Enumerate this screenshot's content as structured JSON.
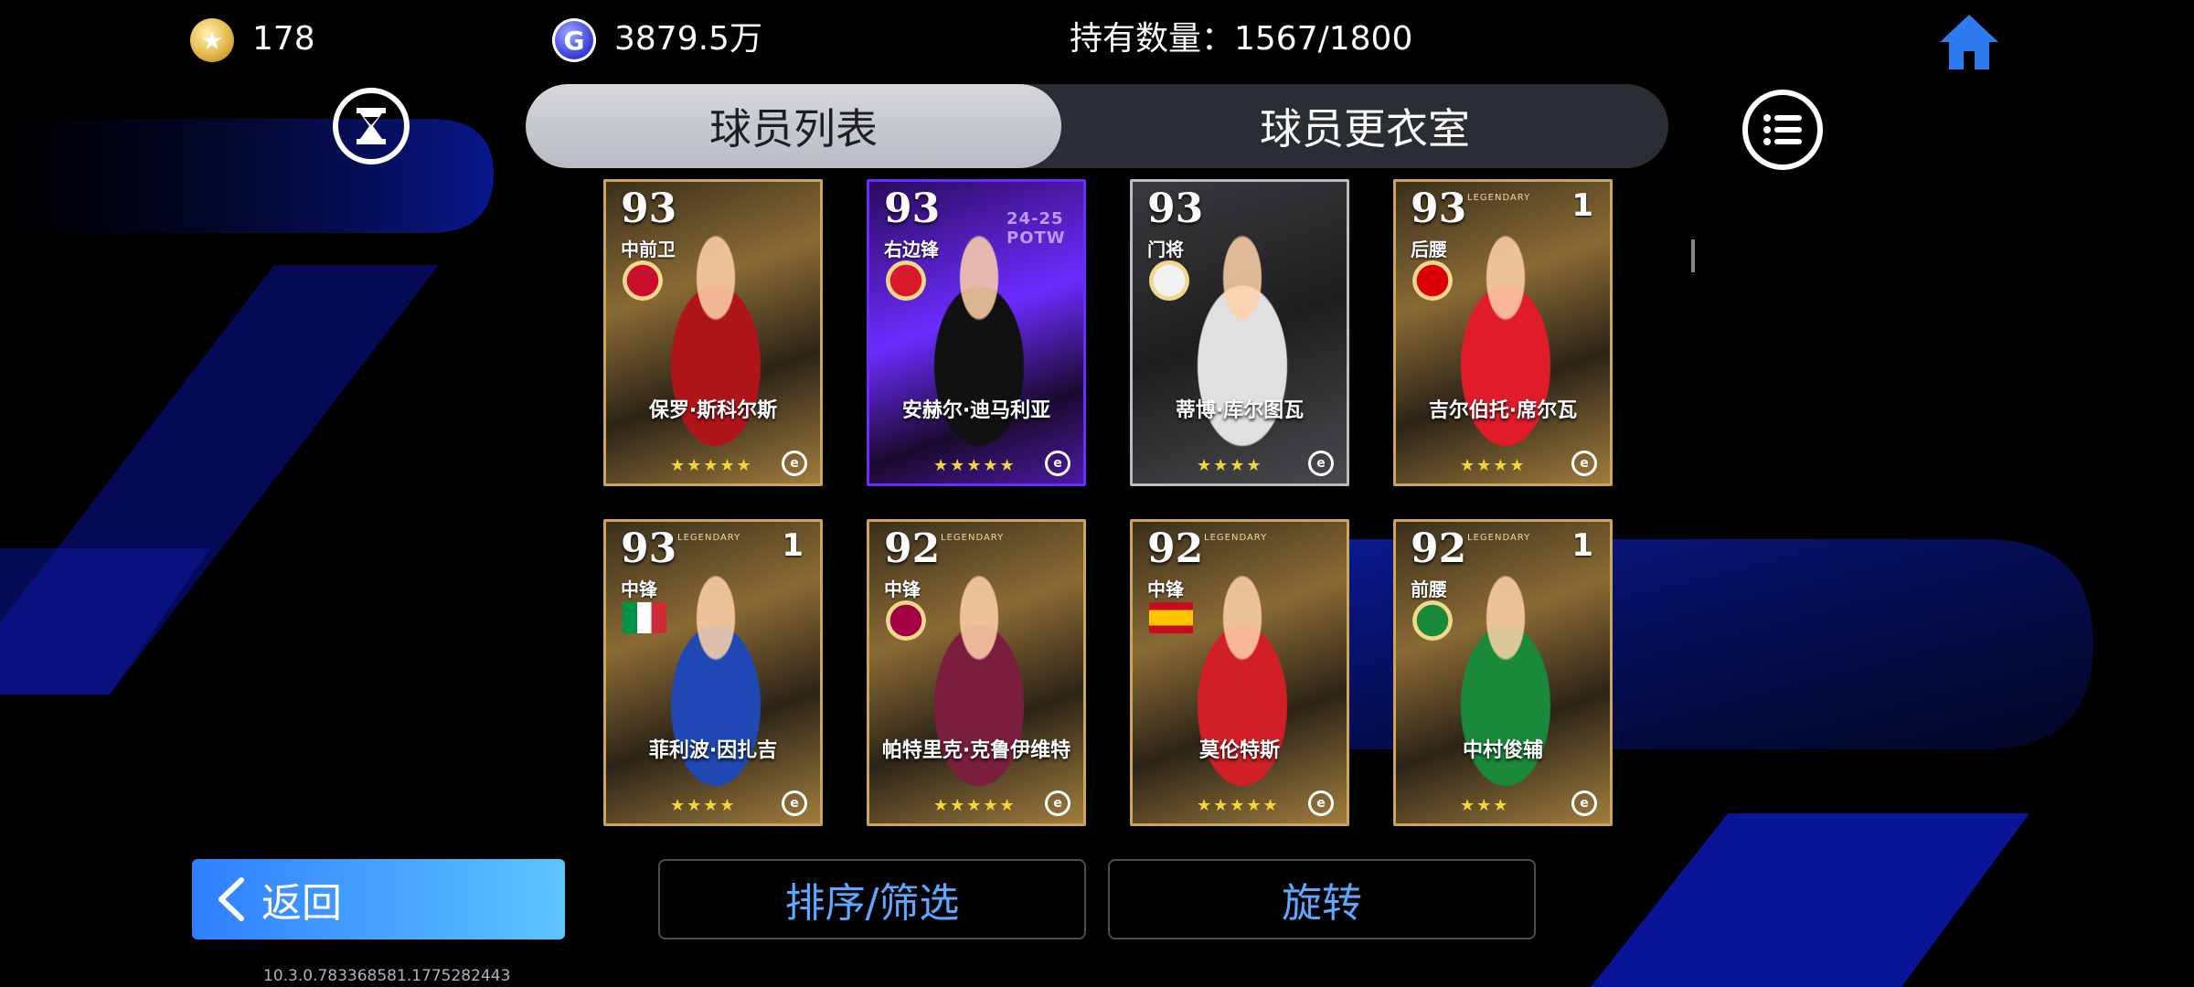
{
  "header": {
    "coins": "178",
    "gp": "3879.5万",
    "ownership": "持有数量：1567/1800",
    "gp_symbol": "G"
  },
  "tabs": [
    {
      "label": "球员列表",
      "active": true
    },
    {
      "label": "球员更衣室",
      "active": false
    }
  ],
  "cards": [
    {
      "rating": "93",
      "position": "中前卫",
      "name": "保罗·斯科尔斯",
      "stars": "★★★★★",
      "level": "",
      "tag": "",
      "style": "gold",
      "kit": "#b0141b",
      "badge": "manchester-united-badge",
      "badge_color": "#c8102e"
    },
    {
      "rating": "93",
      "position": "右边锋",
      "name": "安赫尔·迪马利亚",
      "stars": "★★★★★",
      "level": "",
      "tag": "24-25 POTW",
      "style": "potw",
      "kit": "#111",
      "badge": "benfica-badge",
      "badge_color": "#d81a2a"
    },
    {
      "rating": "93",
      "position": "门将",
      "name": "蒂博·库尔图瓦",
      "stars": "★★★★",
      "level": "",
      "tag": "",
      "style": "silver",
      "kit": "#e0e0e0",
      "badge": "real-madrid-badge",
      "badge_color": "#f2f2f2"
    },
    {
      "rating": "93",
      "position": "后腰",
      "name": "吉尔伯托·席尔瓦",
      "stars": "★★★★",
      "level": "1",
      "tag": "LEGENDARY",
      "style": "gold",
      "kit": "#e01c2a",
      "badge": "arsenal-badge",
      "badge_color": "#db0007"
    },
    {
      "rating": "93",
      "position": "中锋",
      "name": "菲利波·因扎吉",
      "stars": "★★★★",
      "level": "1",
      "tag": "LEGENDARY",
      "style": "gold",
      "kit": "#1f48b4",
      "badge": "italy-flag",
      "badge_color": ""
    },
    {
      "rating": "92",
      "position": "中锋",
      "name": "帕特里克·克鲁伊维特",
      "stars": "★★★★★",
      "level": "",
      "tag": "LEGENDARY",
      "style": "gold",
      "kit": "#7b1d3c",
      "badge": "barcelona-badge",
      "badge_color": "#a50044"
    },
    {
      "rating": "92",
      "position": "中锋",
      "name": "莫伦特斯",
      "stars": "★★★★★",
      "level": "",
      "tag": "LEGENDARY",
      "style": "gold",
      "kit": "#d01f27",
      "badge": "spain-flag",
      "badge_color": ""
    },
    {
      "rating": "92",
      "position": "前腰",
      "name": "中村俊辅",
      "stars": "★★★",
      "level": "1",
      "tag": "LEGENDARY",
      "style": "gold",
      "kit": "#1a8a3a",
      "badge": "celtic-badge",
      "badge_color": "#1a8a3a"
    }
  ],
  "footer": {
    "back_label": "返回",
    "sort_label": "排序/筛选",
    "rotate_label": "旋转",
    "version": "10.3.0.783368581.1775282443"
  },
  "colors": {
    "accent": "#2f7fff",
    "button_text": "#5aa8ff",
    "background": "#000000"
  }
}
